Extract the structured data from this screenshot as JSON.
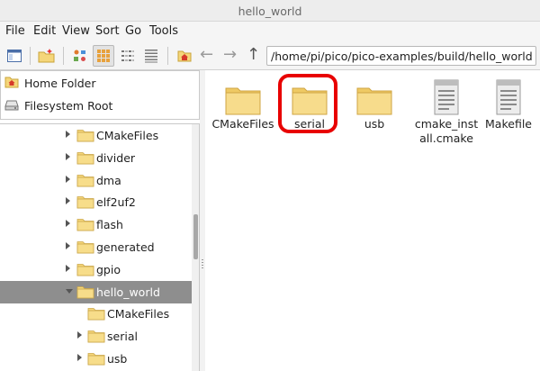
{
  "window": {
    "title": "hello_world"
  },
  "menu": [
    "File",
    "Edit",
    "View",
    "Sort",
    "Go",
    "Tools"
  ],
  "toolbar": {
    "icons": [
      "new-window-icon",
      "new-folder-icon",
      "icon-view-icon",
      "thumbnail-view-icon",
      "compact-view-icon",
      "list-view-icon",
      "home-icon",
      "back-arrow-icon",
      "forward-arrow-icon",
      "up-arrow-icon"
    ],
    "path": "/home/pi/pico/pico-examples/build/hello_world"
  },
  "places": [
    {
      "label": "Home Folder",
      "icon": "home-icon"
    },
    {
      "label": "Filesystem Root",
      "icon": "drive-icon"
    }
  ],
  "tree": [
    {
      "label": "CMakeFiles",
      "expander": "collapsed",
      "indent": 1
    },
    {
      "label": "divider",
      "expander": "collapsed",
      "indent": 1
    },
    {
      "label": "dma",
      "expander": "collapsed",
      "indent": 1
    },
    {
      "label": "elf2uf2",
      "expander": "collapsed",
      "indent": 1
    },
    {
      "label": "flash",
      "expander": "collapsed",
      "indent": 1
    },
    {
      "label": "generated",
      "expander": "collapsed",
      "indent": 1
    },
    {
      "label": "gpio",
      "expander": "collapsed",
      "indent": 1
    },
    {
      "label": "hello_world",
      "expander": "expanded",
      "indent": 1,
      "selected": true
    },
    {
      "label": "CMakeFiles",
      "expander": "none",
      "indent": 2
    },
    {
      "label": "serial",
      "expander": "collapsed",
      "indent": 2
    },
    {
      "label": "usb",
      "expander": "collapsed",
      "indent": 2
    }
  ],
  "files": [
    {
      "name": "CMakeFiles",
      "type": "folder"
    },
    {
      "name": "serial",
      "type": "folder",
      "highlighted": true
    },
    {
      "name": "usb",
      "type": "folder"
    },
    {
      "name": "cmake_install.cmake",
      "type": "file"
    },
    {
      "name": "Makefile",
      "type": "file"
    }
  ],
  "colors": {
    "highlight": "#e80000",
    "folder": "#f5d67a",
    "selected_row": "#8e8e8e"
  }
}
